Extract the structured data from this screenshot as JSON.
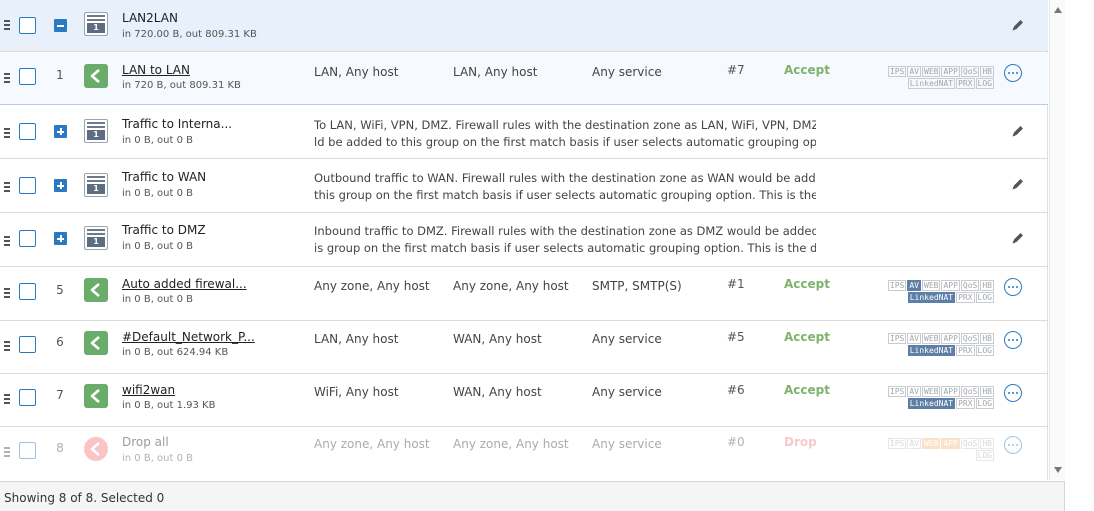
{
  "rows": [
    {
      "name": "LAN2LAN",
      "traffic": "in 720.00 B, out 809.31 KB"
    },
    {
      "num": "1",
      "name": "LAN to LAN",
      "traffic": "in 720 B, out 809.31 KB",
      "source": "LAN, Any host",
      "destination": "LAN, Any host",
      "service": "Any service",
      "id": "#7",
      "action": "Accept"
    },
    {
      "name": "Traffic to Interna...",
      "traffic": "in 0 B, out 0 B",
      "desc1": "To LAN, WiFi, VPN, DMZ. Firewall rules with the destination zone as LAN, WiFi, VPN, DMZ wou",
      "desc2": "ld be added to this group on the first match basis if user selects automatic grouping option..."
    },
    {
      "name": "Traffic to WAN",
      "traffic": "in 0 B, out 0 B",
      "desc1": "Outbound traffic to WAN. Firewall rules with the destination zone as WAN would be added to",
      "desc2": "this group on the first match basis if user selects automatic grouping option. This is the d..."
    },
    {
      "name": "Traffic to DMZ",
      "traffic": "in 0 B, out 0 B",
      "desc1": "Inbound traffic to DMZ. Firewall rules with the destination zone as DMZ would be added to th",
      "desc2": "is group on the first match basis if user selects automatic grouping option. This is the de..."
    },
    {
      "num": "5",
      "name": "Auto added firewal...",
      "traffic": "in 0 B, out 0 B",
      "source": "Any zone, Any host",
      "destination": "Any zone, Any host",
      "service": "SMTP, SMTP(S)",
      "id": "#1",
      "action": "Accept"
    },
    {
      "num": "6",
      "name": "#Default_Network_P...",
      "traffic": "in 0 B, out 624.94 KB",
      "source": "LAN, Any host",
      "destination": "WAN, Any host",
      "service": "Any service",
      "id": "#5",
      "action": "Accept"
    },
    {
      "num": "7",
      "name": "wifi2wan",
      "traffic": "in 0 B, out 1.93 KB",
      "source": "WiFi, Any host",
      "destination": "WAN, Any host",
      "service": "Any service",
      "id": "#6",
      "action": "Accept"
    },
    {
      "num": "8",
      "name": "Drop all",
      "traffic": "in 0 B, out 0 B",
      "source": "Any zone, Any host",
      "destination": "Any zone, Any host",
      "service": "Any service",
      "id": "#0",
      "action": "Drop"
    }
  ],
  "group_icon_label": "1",
  "features": {
    "line1": [
      "IPS",
      "AV",
      "WEB",
      "APP",
      "QoS",
      "HB"
    ],
    "line2_full": [
      "LinkedNAT",
      "PRX",
      "LOG"
    ],
    "line2_drop": [
      "LOG"
    ]
  },
  "footer": {
    "status": "Showing 8 of 8. Selected 0"
  },
  "colors": {
    "accent": "#2a7ac2",
    "accept": "#7db36b",
    "drop": "#f08a8a",
    "rule_icon": "#6aad6a",
    "group_bg": "#e8f0fb"
  }
}
